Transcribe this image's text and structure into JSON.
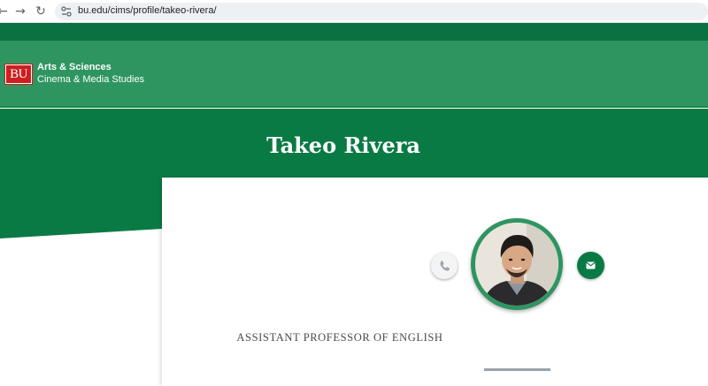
{
  "browser": {
    "url": "bu.edu/cims/profile/takeo-rivera/"
  },
  "header": {
    "logo_text": "BU",
    "college": "Arts & Sciences",
    "department": "Cinema & Media Studies"
  },
  "profile": {
    "name": "Takeo Rivera",
    "title": "ASSISTANT PROFESSOR OF ENGLISH"
  },
  "colors": {
    "dark_green": "#0a7142",
    "header_green": "#2e9561",
    "banner_green": "#0a7a45",
    "bu_red": "#cc1f1f"
  },
  "icons": {
    "phone": "phone-icon",
    "email": "email-icon"
  }
}
